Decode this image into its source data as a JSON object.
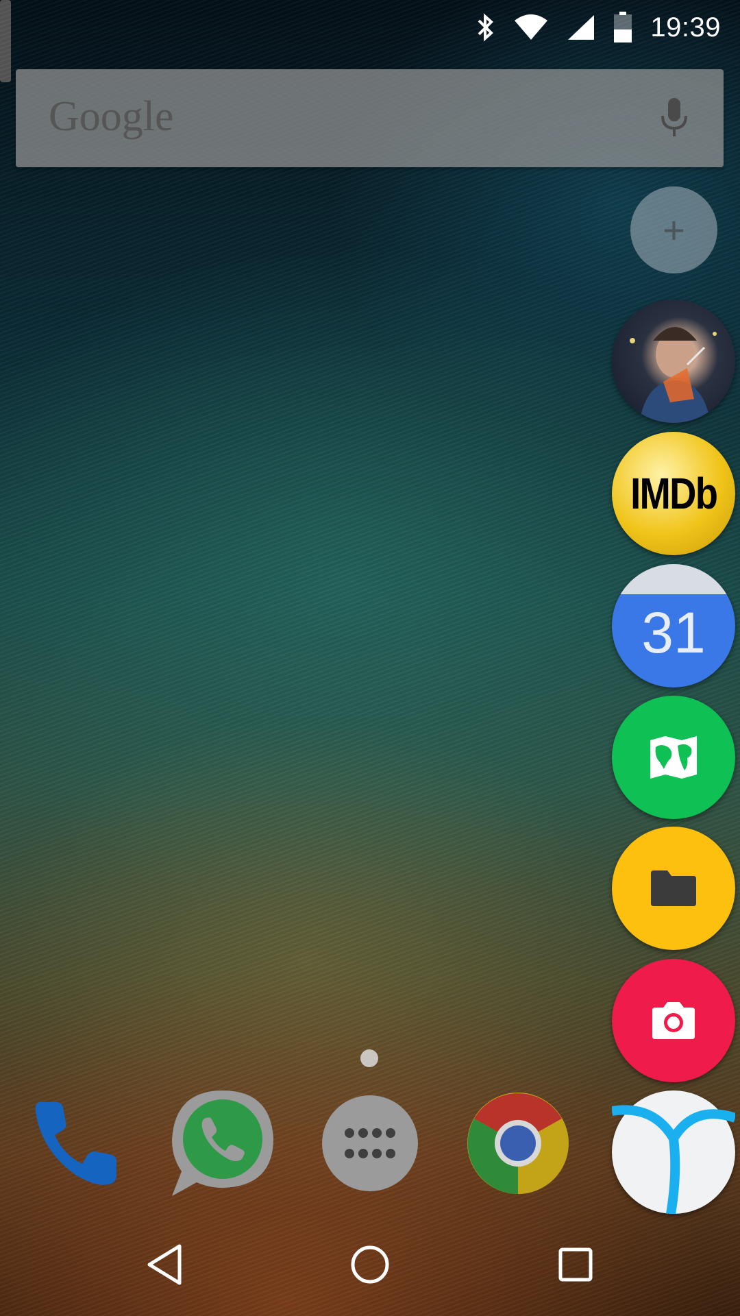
{
  "status_bar": {
    "time": "19:39",
    "icons": [
      "bluetooth-icon",
      "wifi-icon",
      "signal-icon",
      "battery-icon"
    ]
  },
  "search_bar": {
    "logo_text": "Google",
    "mic_icon": "mic-icon"
  },
  "bubbles": {
    "add_label": "+",
    "items": [
      {
        "name": "contact",
        "icon": "contact-photo"
      },
      {
        "name": "imdb",
        "label": "IMDb",
        "color": "#f0c419"
      },
      {
        "name": "calendar",
        "label": "31",
        "color": "#3b78e7"
      },
      {
        "name": "maps",
        "icon": "map-icon",
        "color": "#0fc155"
      },
      {
        "name": "files",
        "icon": "folder-icon",
        "color": "#fdc00f"
      },
      {
        "name": "camera",
        "icon": "camera-icon",
        "color": "#ef1b4b"
      },
      {
        "name": "browser",
        "icon": "browser-icon",
        "color": "#1ab0f0"
      }
    ]
  },
  "dock": {
    "items": [
      "phone-icon",
      "whatsapp-icon",
      "app-drawer-icon",
      "chrome-icon"
    ]
  },
  "nav_bar": {
    "buttons": [
      "back-icon",
      "home-icon",
      "recents-icon"
    ]
  }
}
